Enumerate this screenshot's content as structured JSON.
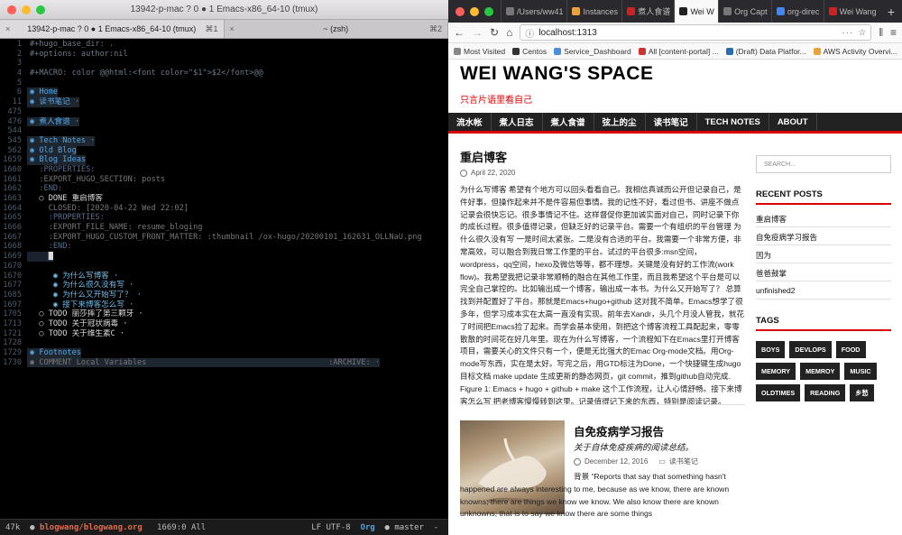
{
  "terminal": {
    "title": "13942-p-mac ? 0 ● 1 Emacs-x86_64-10 (tmux)",
    "tabs": [
      {
        "label": "13942-p-mac ? 0 ● 1 Emacs-x86_64-10 (tmux)",
        "shortcut": "⌘1",
        "active": true
      },
      {
        "label": "~ (zsh)",
        "shortcut": "⌘2",
        "active": false
      }
    ],
    "lines": [
      {
        "num": "1",
        "text": "#+hugo_base_dir: .",
        "cls": "c-comment"
      },
      {
        "num": "2",
        "text": "#+options: author:nil",
        "cls": "c-comment"
      },
      {
        "num": "3",
        "text": "",
        "cls": ""
      },
      {
        "num": "4",
        "text": "#+MACRO: color @@html:<font color=\"$1\">$2</font>@@",
        "cls": "c-comment"
      },
      {
        "num": "5",
        "text": "",
        "cls": ""
      },
      {
        "num": "6",
        "text": "◉ Home",
        "cls": "c-head hl"
      },
      {
        "num": "11",
        "text": "◉ 读书笔记 ·",
        "cls": "c-head hl"
      },
      {
        "num": "475",
        "text": "",
        "cls": ""
      },
      {
        "num": "476",
        "text": "◉ 煮人食谱 ·",
        "cls": "c-head hl"
      },
      {
        "num": "544",
        "text": "",
        "cls": ""
      },
      {
        "num": "545",
        "text": "◉ Tech Notes ·",
        "cls": "c-head hl"
      },
      {
        "num": "562",
        "text": "◉ Old Blog",
        "cls": "c-head hl"
      },
      {
        "num": "1659",
        "text": "◉ Blog Ideas",
        "cls": "c-head hl"
      },
      {
        "num": "1660",
        "text": "  :PROPERTIES:",
        "cls": "c-prop"
      },
      {
        "num": "1661",
        "text": "  :EXPORT_HUGO_SECTION: posts",
        "cls": "c-dim"
      },
      {
        "num": "1662",
        "text": "  :END:",
        "cls": "c-prop"
      },
      {
        "num": "1663",
        "text": "  ○ DONE 重启博客",
        "cls": "c-todo"
      },
      {
        "num": "1664",
        "text": "    CLOSED: [2020-04-22 Wed 22:02]",
        "cls": "c-dim"
      },
      {
        "num": "1665",
        "text": "    :PROPERTIES:",
        "cls": "c-prop"
      },
      {
        "num": "1666",
        "text": "    :EXPORT_FILE_NAME: resume_bloging",
        "cls": "c-dim"
      },
      {
        "num": "1667",
        "text": "    :EXPORT_HUGO_CUSTOM_FRONT_MATTER: :thumbnail /ox-hugo/20200101_162631_OLLNaU.png",
        "cls": "c-dim"
      },
      {
        "num": "1668",
        "text": "    :END:",
        "cls": "c-prop"
      },
      {
        "num": "1669",
        "text": "    █",
        "cls": "c-todo cur"
      },
      {
        "num": "1670",
        "text": "",
        "cls": ""
      },
      {
        "num": "1670",
        "text": "     ◉ 为什么写博客 ·",
        "cls": "c-head2"
      },
      {
        "num": "1677",
        "text": "     ◉ 为什么很久没有写 ·",
        "cls": "c-head2"
      },
      {
        "num": "1685",
        "text": "     ◉ 为什么又开始写了？ ·",
        "cls": "c-head2"
      },
      {
        "num": "1697",
        "text": "     ◉ 接下来博客怎么写 ·",
        "cls": "c-head2"
      },
      {
        "num": "1705",
        "text": "  ○ TODO 丽莎摔了第三颗牙 ·",
        "cls": "c-todo"
      },
      {
        "num": "1713",
        "text": "  ○ TODO 关于冠状病毒 ·",
        "cls": "c-todo"
      },
      {
        "num": "1721",
        "text": "  ○ TODO 关于维生素C ·",
        "cls": "c-todo"
      },
      {
        "num": "1728",
        "text": "",
        "cls": ""
      },
      {
        "num": "1729",
        "text": "◉ Footnotes",
        "cls": "c-head hl"
      },
      {
        "num": "1730",
        "text": "◉ COMMENT Local Variables                                       :ARCHIVE: ·",
        "cls": "c-dim hl"
      }
    ],
    "modeline": {
      "size": "47k",
      "file": "blogwang/blogwang.org",
      "position": "1669:0 All",
      "encoding": "LF UTF-8",
      "mode": "Org",
      "branch": "master"
    }
  },
  "browser": {
    "tabs": [
      {
        "label": "/Users/ww41",
        "color": "#777"
      },
      {
        "label": "Instances",
        "color": "#e8a33d"
      },
      {
        "label": "煮人食谱",
        "color": "#c22"
      },
      {
        "label": "Wei W",
        "color": "#222",
        "active": true
      },
      {
        "label": "Org Capt",
        "color": "#777"
      },
      {
        "label": "org-direc",
        "color": "#4285f4"
      },
      {
        "label": "Wei Wang",
        "color": "#c22"
      }
    ],
    "url": "localhost:1313",
    "bookmarks": [
      "Most Visited",
      "Centos",
      "Service_Dashboard",
      "All [content-portal] ...",
      "(Draft) Data Platfor...",
      "AWS Activity Overvi..."
    ]
  },
  "site": {
    "title": "WEI WANG'S SPACE",
    "tagline": "只言片语里看自己",
    "menu": [
      "流水帐",
      "煮人日志",
      "煮人食谱",
      "弦上的尘",
      "读书笔记",
      "TECH NOTES",
      "ABOUT"
    ],
    "post1": {
      "title": "重启博客",
      "date": "April 22, 2020",
      "body": "为什么写博客 希望有个地方可以回头看看自己。我相信真诚而公开但记录自己，是件好事，但操作起来并不是件容易但事情。我的记性不好，看过但书、讲座不做点记录会很快忘记。很多事情记不住。这样督促你更加诚实面对自己，同时记录下你的成长过程。很多值得记录，但缺乏好的记录平台。需要一个有组织的平台管理 为什么很久没有写 一是时间太紧张。二是没有合适的平台。我需要一个非常方便，非常高效，可以融合到我日常工作里的平台。试过的平台很多:msn空间，wordpress，qq空间，hexo及微信等等，都不理想。关键是没有好的工作流(work flow)。我希望我把记录非常顺畅的融合在其他工作里，而且我希望这个平台是可以完全自己掌控的。比如输出成一个博客，输出成一本书。为什么又开始写了？ 总算找到并配置好了平台。那就是Emacs+hugo+github 这对我不简单。Emacs想学了很多年，但学习成本实在太高一直没有实现。前年去Xandr，头几个月没人管我，就花了时间把Emacs捡了起来。而学会基本使用，到把这个博客流程工具配起来，零零散散的时间花在好几年里。现在为什么写博客，一个流程知下在Emacs里打开博客项目，需要关心的文件只有一个，便是无比强大的Emac Org-mode文档。用Org-mode写东西，实在是太好。写完之后，用GTD标注为Done，一个快捷键生成hugo目标文档 make update 生成更新的静态网页，git commit，推到github自动完成. Figure 1: Emacs + hugo + github + make 这个工作流程，让人心情舒畅。接下来博客怎么写 把老博客慢慢转到这里。记录值得记下来的东西，特别是阅读记录。"
    },
    "post2": {
      "title": "自免疫病学习报告",
      "subtitle": "关于自体免疫疾病的阅读总结。",
      "date": "December 12, 2016",
      "category": "读书笔记",
      "body": "背景 “Reports that say that something hasn't happened are always interesting to me, because as we know, there are known knowns; there are things we know we know. We also know there are known unknowns; that is to say we know there are some things"
    },
    "sidebar": {
      "search_placeholder": "SEARCH...",
      "recent_heading": "RECENT POSTS",
      "recent": [
        "重启博客",
        "自免疫病学习报告",
        "因为",
        "爸爸鼓掌",
        "unfinished2"
      ],
      "tags_heading": "TAGS",
      "tags": [
        "BOYS",
        "DEVLOPS",
        "FOOD",
        "MEMORY",
        "MEMROY",
        "MUSIC",
        "OLDTIMES",
        "READING",
        "乡愁"
      ]
    }
  }
}
